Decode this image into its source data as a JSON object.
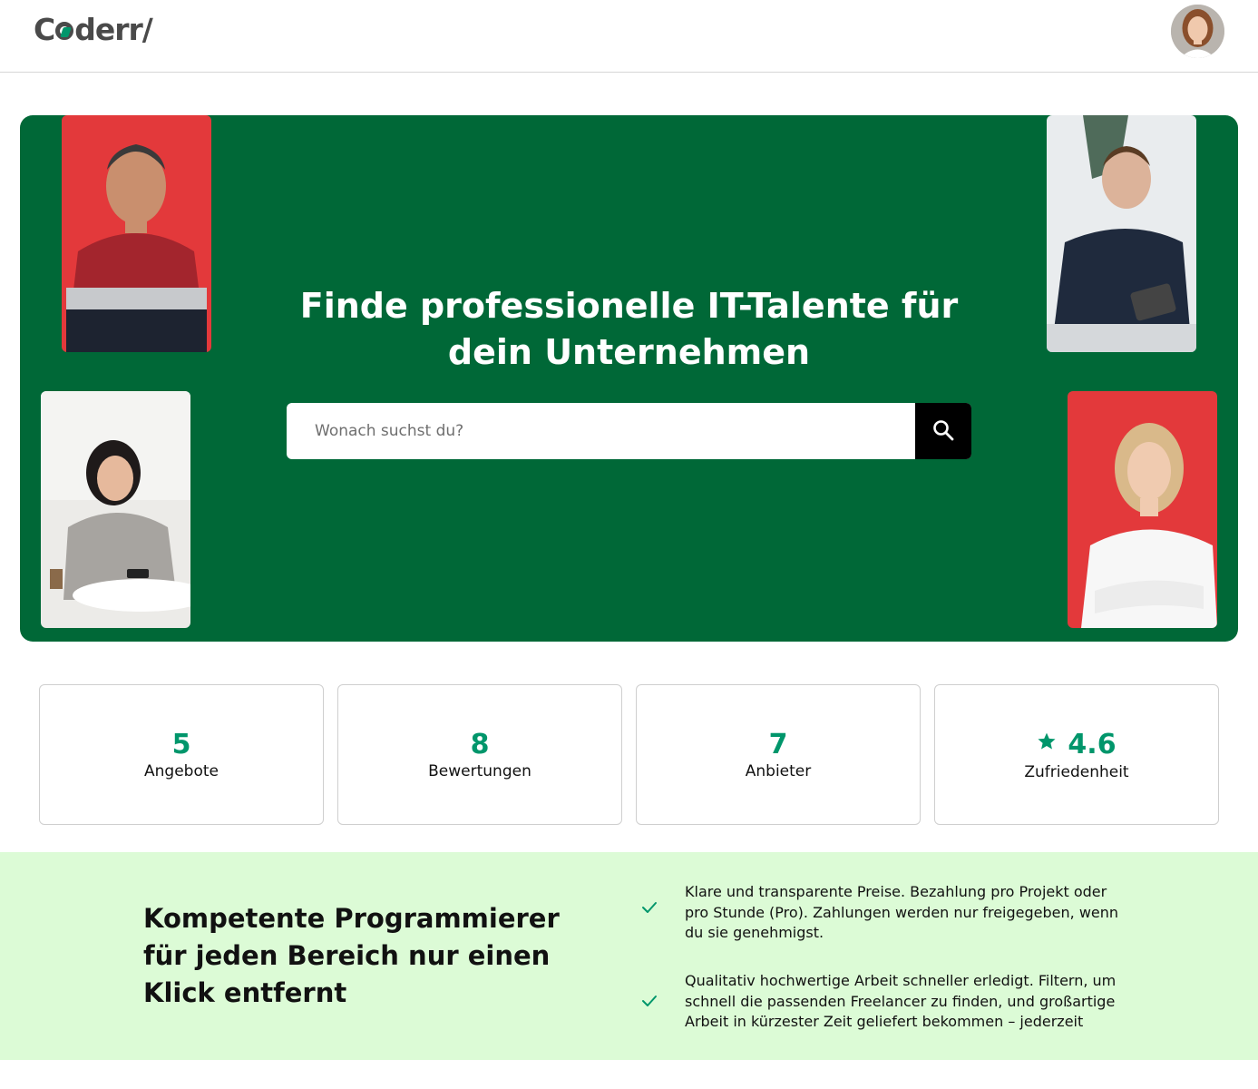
{
  "header": {
    "logo_text": "Coderr/",
    "avatar_alt": "user-avatar"
  },
  "hero": {
    "title": "Finde professionelle IT-Talente für dein Unternehmen",
    "search_placeholder": "Wonach suchst du?",
    "search_icon": "search-icon",
    "colors": {
      "background": "#006837",
      "photo_red": "#e3393b"
    }
  },
  "stats": [
    {
      "value": "5",
      "label": "Angebote"
    },
    {
      "value": "8",
      "label": "Bewertungen"
    },
    {
      "value": "7",
      "label": "Anbieter"
    },
    {
      "value": "4.6",
      "label": "Zufriedenheit",
      "icon": "star-icon"
    }
  ],
  "features": {
    "title": "Kompetente Programmierer für jeden Bereich nur einen Klick entfernt",
    "items": [
      {
        "icon": "check-icon",
        "text": "Klare und transparente Preise. Bezahlung pro Projekt oder pro Stunde (Pro). Zahlungen werden nur freigegeben, wenn du sie genehmigst."
      },
      {
        "icon": "check-icon",
        "text": "Qualitativ hochwertige Arbeit schneller erledigt. Filtern, um schnell die passenden Freelancer zu finden, und großartige Arbeit in kürzester Zeit geliefert bekommen – jederzeit"
      }
    ],
    "colors": {
      "background": "#dcfbd6",
      "accent": "#00966b"
    }
  }
}
